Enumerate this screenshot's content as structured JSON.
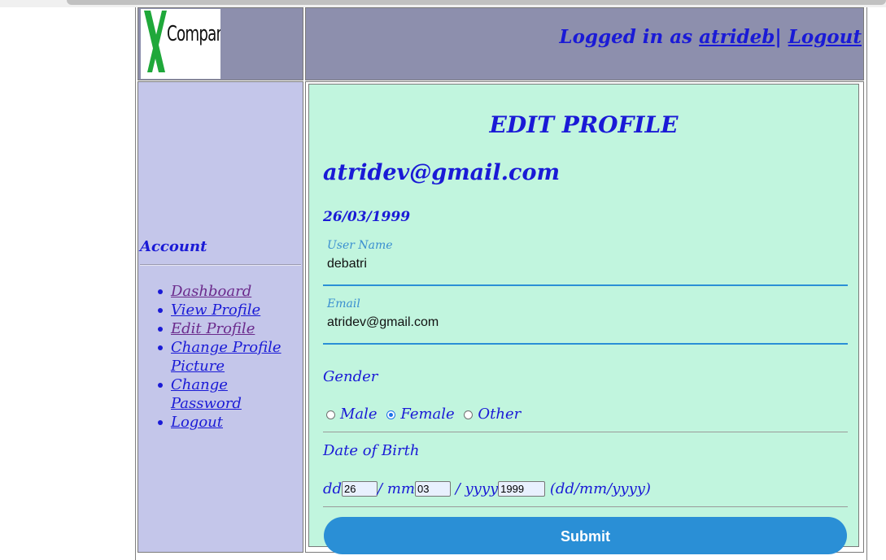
{
  "logo": {
    "text": "Company",
    "mark": "X"
  },
  "header": {
    "logged_in_prefix": "Logged in as ",
    "username_link": "atrideb",
    "separator": "| ",
    "logout_link": "Logout"
  },
  "sidebar": {
    "title": "Account",
    "items": [
      {
        "label": "Dashboard",
        "visited": true
      },
      {
        "label": "View Profile",
        "visited": false
      },
      {
        "label": "Edit Profile",
        "visited": true
      },
      {
        "label": "Change Profile Picture",
        "visited": false
      },
      {
        "label": "Change Password",
        "visited": false
      },
      {
        "label": "Logout",
        "visited": false
      }
    ]
  },
  "main": {
    "title": "EDIT PROFILE",
    "email_heading": "atridev@gmail.com",
    "dob_heading": "26/03/1999",
    "username_field": {
      "label": "User Name",
      "value": "debatri"
    },
    "email_field": {
      "label": "Email",
      "value": "atridev@gmail.com"
    },
    "gender": {
      "label": "Gender",
      "options": [
        {
          "label": "Male",
          "checked": false
        },
        {
          "label": "Female",
          "checked": true
        },
        {
          "label": "Other",
          "checked": false
        }
      ]
    },
    "dob": {
      "label": "Date of Birth",
      "dd_prefix": "dd",
      "dd_value": "26",
      "mm_prefix": "/ mm",
      "mm_value": "03",
      "yyyy_prefix": " / yyyy",
      "yyyy_value": "1999",
      "format_hint": " (dd/mm/yyyy)"
    },
    "submit_label": "Submit"
  },
  "colors": {
    "header_bg": "#8d8fad",
    "sidebar_bg": "#c4c6ea",
    "content_bg": "#c1f5de",
    "link": "#1a1ad6",
    "visited_link": "#6b2a8c",
    "accent": "#2a8fd6"
  }
}
